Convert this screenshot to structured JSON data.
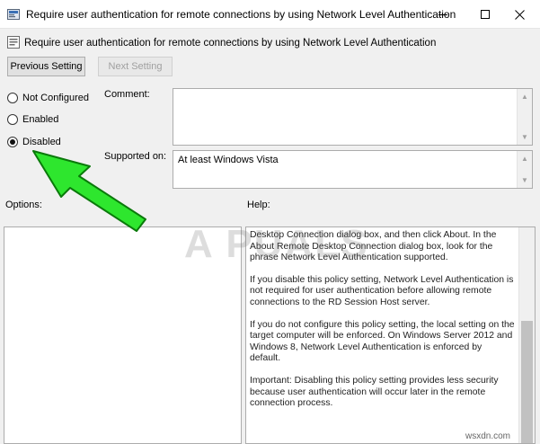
{
  "window": {
    "title": "Require user authentication for remote connections by using Network Level Authentication"
  },
  "header": {
    "setting_title": "Require user authentication for remote connections by using Network Level Authentication"
  },
  "toolbar": {
    "previous_label": "Previous Setting",
    "next_label": "Next Setting"
  },
  "state": {
    "options": [
      {
        "label": "Not Configured",
        "checked": false
      },
      {
        "label": "Enabled",
        "checked": false
      },
      {
        "label": "Disabled",
        "checked": true
      }
    ]
  },
  "comment": {
    "label": "Comment:",
    "value": ""
  },
  "supported": {
    "label": "Supported on:",
    "value": "At least Windows Vista"
  },
  "options_panel": {
    "label": "Options:"
  },
  "help_panel": {
    "label": "Help:",
    "paragraphs": [
      "Desktop Connection dialog box, and then click About. In the About Remote Desktop Connection dialog box, look for the phrase Network Level Authentication supported.",
      "If you disable this policy setting, Network Level Authentication is not required for user authentication before allowing remote connections to the RD Session Host server.",
      "If you do not configure this policy setting, the local setting on the target computer will be enforced. On Windows Server 2012 and Windows 8, Network Level Authentication is enforced by default.",
      "Important: Disabling this policy setting provides less security because user authentication will occur later in the remote connection process."
    ]
  },
  "watermarks": {
    "logo_text": "A  PUALS",
    "site": "wsxdn.com"
  },
  "colors": {
    "arrow": "#2ee62e",
    "arrow_outline": "#0a7a0a"
  }
}
